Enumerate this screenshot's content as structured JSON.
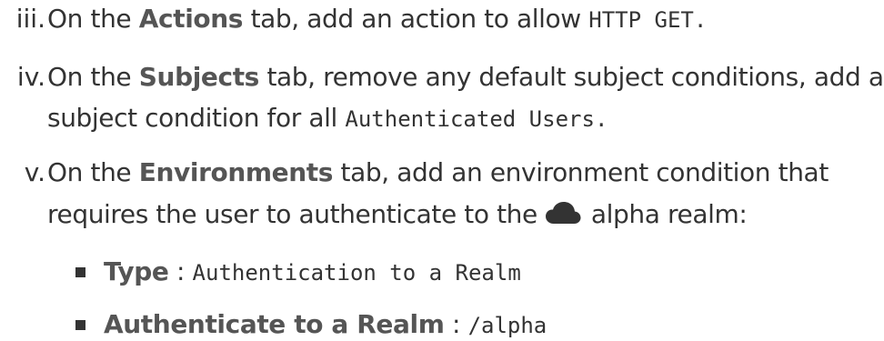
{
  "items": [
    {
      "marker": "iii.",
      "prefix": "On the",
      "tab": "Actions",
      "text": "tab, add an action to allow",
      "code": "HTTP GET",
      "suffix": "."
    },
    {
      "marker": "iv.",
      "prefix": "On the",
      "tab": "Subjects",
      "text": "tab, remove any default subject conditions, add a",
      "line2_text": "subject condition for all",
      "code": "Authenticated Users",
      "suffix": "."
    },
    {
      "marker": "v.",
      "prefix": "On the",
      "tab": "Environments",
      "text": "tab, add an environment condition that",
      "line2_before": "requires the user to authenticate to the",
      "icon": "cloud-icon",
      "line2_after": "alpha realm:"
    }
  ],
  "sub_items": [
    {
      "label": "Type",
      "separator": ":",
      "value": "Authentication to a Realm"
    },
    {
      "label": "Authenticate to a Realm",
      "separator": ":",
      "value": "/alpha"
    }
  ]
}
